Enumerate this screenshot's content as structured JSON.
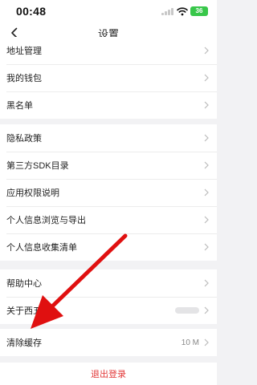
{
  "status_bar": {
    "time": "00:48",
    "battery": "36"
  },
  "header": {
    "title": "设置",
    "back_icon": "chevron-left-icon"
  },
  "groups": [
    {
      "items": [
        {
          "label": "地址管理"
        },
        {
          "label": "我的钱包"
        },
        {
          "label": "黑名单"
        }
      ]
    },
    {
      "items": [
        {
          "label": "隐私政策"
        },
        {
          "label": "第三方SDK目录"
        },
        {
          "label": "应用权限说明"
        },
        {
          "label": "个人信息浏览与导出"
        },
        {
          "label": "个人信息收集清单"
        }
      ]
    },
    {
      "items": [
        {
          "label": "帮助中心"
        },
        {
          "label": "关于西五"
        }
      ]
    },
    {
      "items": [
        {
          "label": "清除缓存",
          "value": "10 M"
        }
      ]
    }
  ],
  "logout": {
    "label": "退出登录"
  },
  "colors": {
    "accent_red": "#e23838",
    "battery_green": "#38c74a",
    "background": "#f2f2f4"
  },
  "annotation": {
    "icon": "red-arrow-annotation-icon"
  }
}
